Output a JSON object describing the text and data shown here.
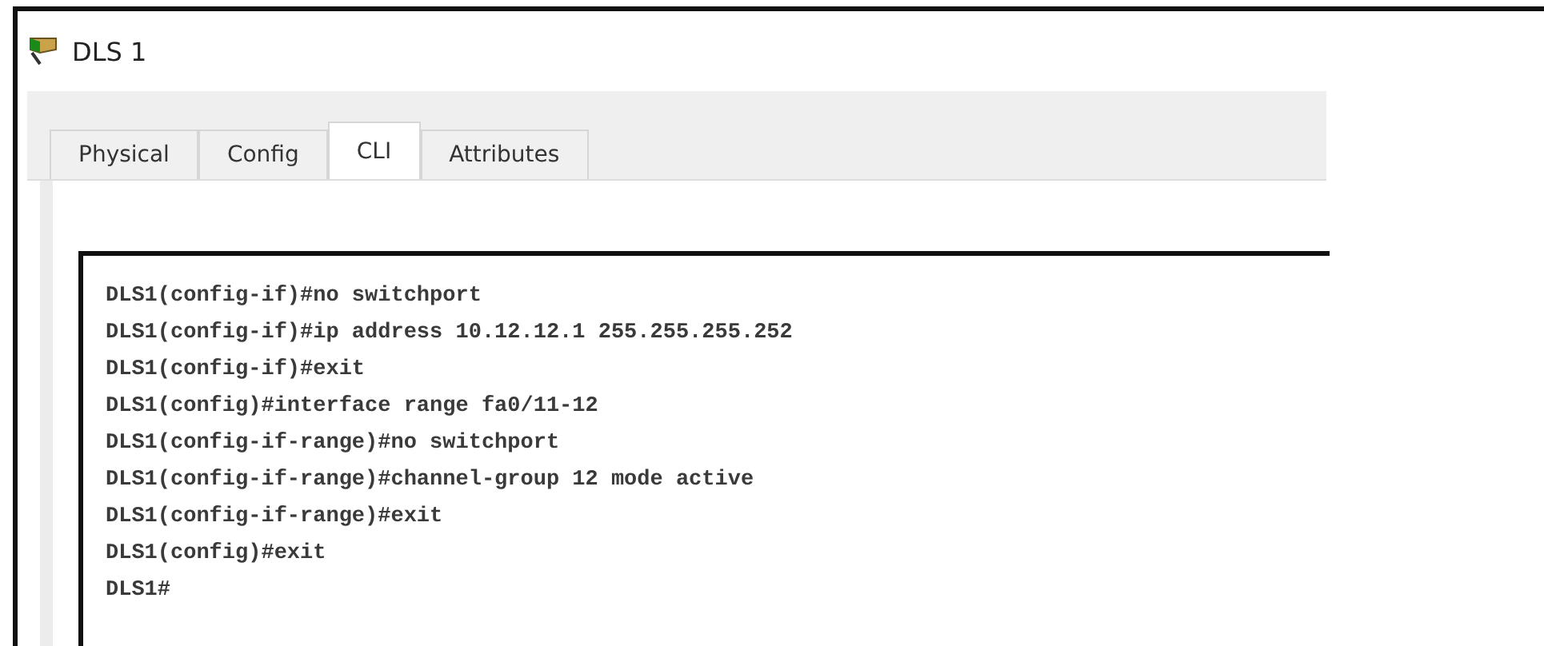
{
  "window": {
    "title": "DLS 1"
  },
  "tabs": [
    {
      "label": "Physical",
      "selected": false
    },
    {
      "label": "Config",
      "selected": false
    },
    {
      "label": "CLI",
      "selected": true
    },
    {
      "label": "Attributes",
      "selected": false
    }
  ],
  "terminal": {
    "lines": [
      "DLS1(config-if)#no switchport",
      "DLS1(config-if)#ip address 10.12.12.1 255.255.255.252",
      "DLS1(config-if)#exit",
      "DLS1(config)#interface range fa0/11-12",
      "DLS1(config-if-range)#no switchport",
      "DLS1(config-if-range)#channel-group 12 mode active",
      "DLS1(config-if-range)#exit",
      "DLS1(config)#exit",
      "DLS1#"
    ]
  }
}
